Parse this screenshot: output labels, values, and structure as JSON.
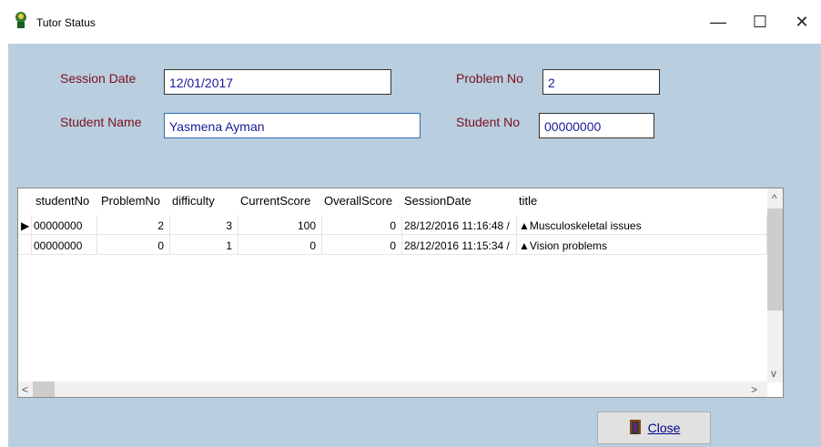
{
  "window": {
    "title": "Tutor Status"
  },
  "form": {
    "session_date_label": "Session Date",
    "session_date_value": "12/01/2017",
    "student_name_label": "Student Name",
    "student_name_value": "Yasmena Ayman",
    "problem_no_label": "Problem No",
    "problem_no_value": "2",
    "student_no_label": "Student No",
    "student_no_value": "00000000"
  },
  "table": {
    "columns": [
      "studentNo",
      "ProblemNo",
      "difficulty",
      "CurrentScore",
      "OverallScore",
      "SessionDate",
      "title"
    ],
    "rows": [
      {
        "studentNo": "00000000",
        "ProblemNo": "2",
        "difficulty": "3",
        "CurrentScore": "100",
        "OverallScore": "0",
        "SessionDate": "28/12/2016 11:16:48 /",
        "title": "Musculoskeletal issues"
      },
      {
        "studentNo": "00000000",
        "ProblemNo": "0",
        "difficulty": "1",
        "CurrentScore": "0",
        "OverallScore": "0",
        "SessionDate": "28/12/2016 11:15:34 /",
        "title": "Vision problems"
      }
    ]
  },
  "buttons": {
    "close_label": "Close"
  },
  "icons": {
    "app": "tutor-icon",
    "minimize": "minimize-icon",
    "maximize": "maximize-icon",
    "close": "close-icon",
    "row_pointer": "row-pointer-icon",
    "exit": "exit-door-icon"
  }
}
